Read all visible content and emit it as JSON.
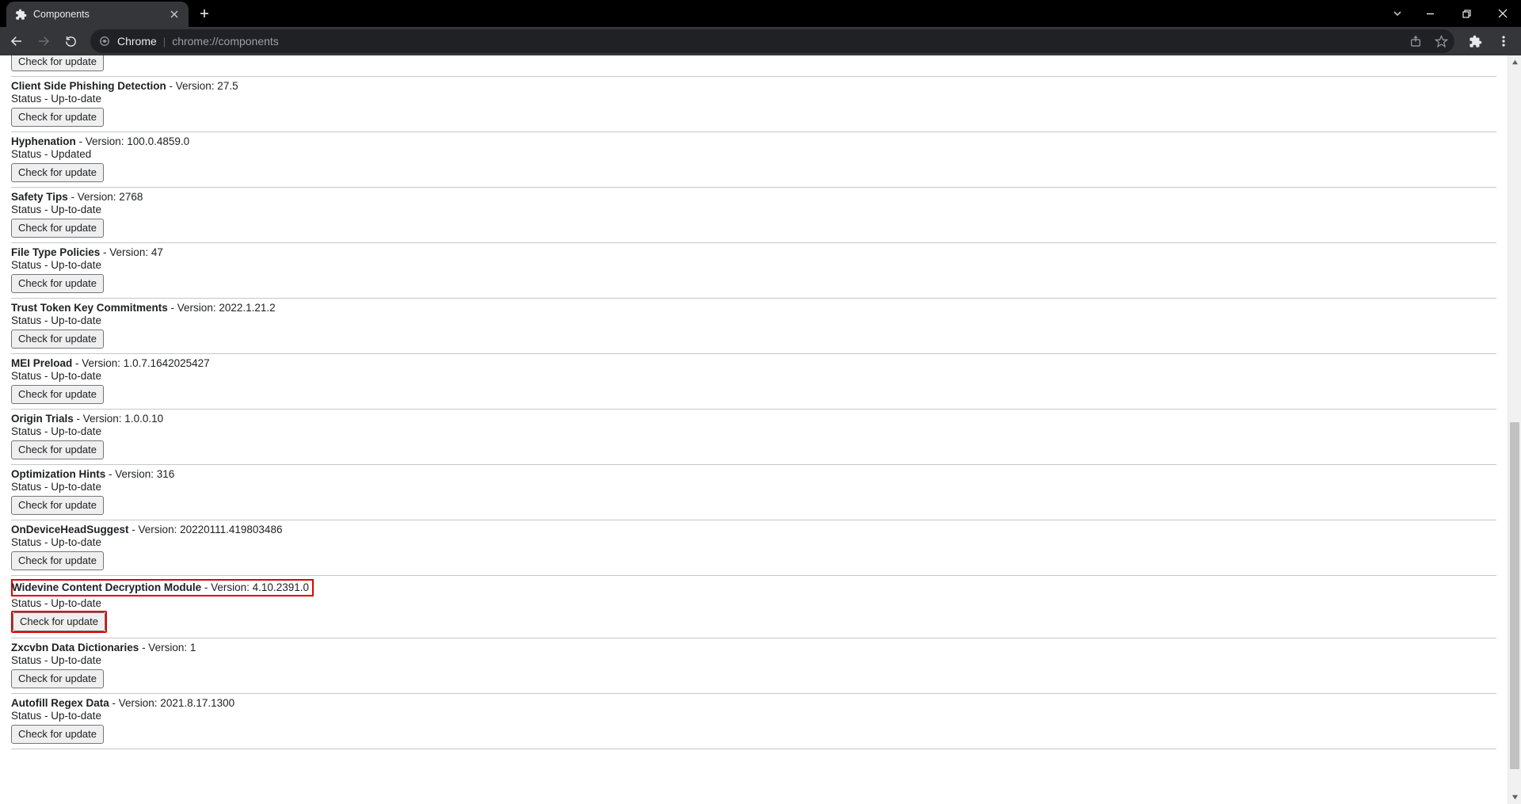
{
  "window": {
    "tab_title": "Components"
  },
  "toolbar": {
    "url_scheme_label": "Chrome",
    "url_rest": "chrome://components"
  },
  "labels": {
    "version_prefix": " - Version: ",
    "status_prefix": "Status - ",
    "check_button": "Check for update"
  },
  "components": [
    {
      "name": "",
      "version": "",
      "status": "",
      "partial_top": true
    },
    {
      "name": "Client Side Phishing Detection",
      "version": "27.5",
      "status": "Up-to-date"
    },
    {
      "name": "Hyphenation",
      "version": "100.0.4859.0",
      "status": "Updated"
    },
    {
      "name": "Safety Tips",
      "version": "2768",
      "status": "Up-to-date"
    },
    {
      "name": "File Type Policies",
      "version": "47",
      "status": "Up-to-date"
    },
    {
      "name": "Trust Token Key Commitments",
      "version": "2022.1.21.2",
      "status": "Up-to-date"
    },
    {
      "name": "MEI Preload",
      "version": "1.0.7.1642025427",
      "status": "Up-to-date"
    },
    {
      "name": "Origin Trials",
      "version": "1.0.0.10",
      "status": "Up-to-date"
    },
    {
      "name": "Optimization Hints",
      "version": "316",
      "status": "Up-to-date"
    },
    {
      "name": "OnDeviceHeadSuggest",
      "version": "20220111.419803486",
      "status": "Up-to-date"
    },
    {
      "name": "Widevine Content Decryption Module",
      "version": "4.10.2391.0",
      "status": "Up-to-date",
      "highlight": true
    },
    {
      "name": "Zxcvbn Data Dictionaries",
      "version": "1",
      "status": "Up-to-date"
    },
    {
      "name": "Autofill Regex Data",
      "version": "2021.8.17.1300",
      "status": "Up-to-date"
    }
  ]
}
